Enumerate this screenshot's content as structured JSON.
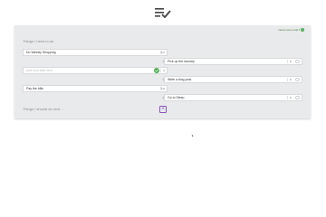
{
  "header": {
    "logo_icon": "checklist-icon"
  },
  "help": {
    "label": "Need some help?",
    "icon": "info-icon"
  },
  "sections": {
    "need": "Things I need to do . . .",
    "should": "Things I should do next . . ."
  },
  "left_tasks": [
    {
      "text": "Do Weekly Shopping",
      "count": "2"
    },
    {
      "placeholder": "Add new task here",
      "count": "0"
    },
    {
      "text": "Pay the bills",
      "count": "0"
    }
  ],
  "right_tasks": [
    {
      "text": "Pick up the laundry",
      "count": "0"
    },
    {
      "text": "Write a blog post",
      "count": "0"
    },
    {
      "text": "Go to Sleep",
      "count": "0"
    }
  ],
  "colors": {
    "accent_green": "#4caf50",
    "add_button": "#8a4fbf",
    "panel_bg": "#e9eaec"
  }
}
